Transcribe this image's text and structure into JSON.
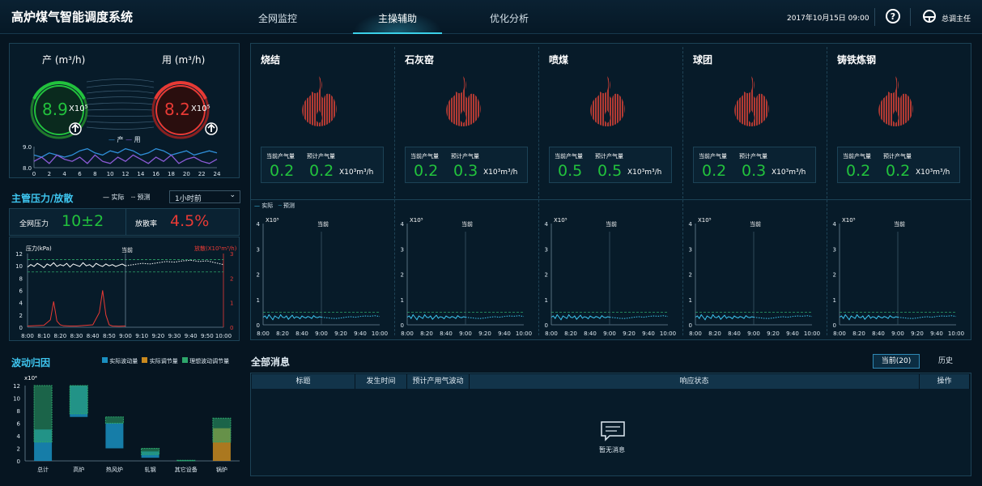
{
  "header": {
    "title": "高炉煤气智能调度系统",
    "nav": [
      "全网监控",
      "主操辅助",
      "优化分析"
    ],
    "active_nav": "主操辅助",
    "datetime": "2017年10月15日  09:00",
    "help_icon": "question-circle-icon",
    "user_icon": "user-icon",
    "user": "总调主任"
  },
  "gauge": {
    "prod_label": "产 (m³/h)",
    "use_label": "用 (m³/h)",
    "prod_value": "8.9",
    "use_value": "8.2",
    "multiplier": "X10⁵",
    "prod_color": "#22c23d",
    "use_color": "#e83a35",
    "up_arrow_icon": "arrow-up-icon",
    "legend_prod": "产",
    "legend_use": "用",
    "chart_data": {
      "type": "line",
      "x": [
        0,
        1,
        2,
        3,
        4,
        5,
        6,
        7,
        8,
        9,
        10,
        11,
        12,
        13,
        14,
        15,
        16,
        17,
        18,
        19,
        20,
        21,
        22,
        23,
        24
      ],
      "xticks": [
        "0",
        "2",
        "4",
        "6",
        "8",
        "10",
        "12",
        "14",
        "16",
        "18",
        "20",
        "22",
        "24"
      ],
      "yticks": [
        "9.0",
        "8.0"
      ],
      "ylim": [
        8.0,
        9.0
      ],
      "series": [
        {
          "name": "产",
          "color": "#2f8fd8",
          "values": [
            8.6,
            8.5,
            8.7,
            8.6,
            8.5,
            8.6,
            8.8,
            8.9,
            8.7,
            8.6,
            8.8,
            8.7,
            8.9,
            8.8,
            8.6,
            8.7,
            8.9,
            8.8,
            8.6,
            8.7,
            8.8,
            8.6,
            8.7,
            8.8,
            8.7
          ]
        },
        {
          "name": "用",
          "color": "#8c5bd6",
          "values": [
            8.3,
            8.5,
            8.2,
            8.6,
            8.4,
            8.3,
            8.5,
            8.2,
            8.6,
            8.3,
            8.2,
            8.5,
            8.3,
            8.6,
            8.4,
            8.2,
            8.5,
            8.3,
            8.6,
            8.2,
            8.4,
            8.5,
            8.3,
            8.2,
            8.4
          ]
        }
      ]
    }
  },
  "pressure": {
    "title": "主管压力/放散",
    "legend_actual": "实际",
    "legend_pred": "预测",
    "select": "1小时前",
    "net_label": "全网压力",
    "net_value": "10±2",
    "diss_label": "放散率",
    "diss_value": "4.5%",
    "left_axis": "压力(kPa)",
    "right_axis": "放散(X10⁵m³/h)",
    "now_label": "当前",
    "chart_data": {
      "type": "line",
      "xticks": [
        "8:00",
        "8:10",
        "8:20",
        "8:30",
        "8:40",
        "8:50",
        "9:00",
        "9:10",
        "9:20",
        "9:30",
        "9:40",
        "9:50",
        "10:00"
      ],
      "yticks_left": [
        "0",
        "2",
        "4",
        "6",
        "8",
        "10",
        "12"
      ],
      "yticks_right": [
        "0",
        "1",
        "2",
        "3"
      ],
      "ylim_left": [
        0,
        12
      ],
      "ylim_right": [
        0,
        3
      ],
      "band": [
        9.0,
        11.0
      ],
      "now": "9:00",
      "series": [
        {
          "name": "实际压力",
          "color": "#ffffff",
          "x": [
            0,
            2,
            4,
            6,
            8,
            10,
            12,
            14,
            16,
            18,
            20,
            22,
            24,
            26,
            28,
            30,
            32,
            34,
            36,
            38,
            40,
            42,
            44,
            46,
            48,
            50,
            52,
            54,
            56,
            58,
            60
          ],
          "values": [
            9.8,
            10.2,
            9.9,
            10.4,
            10.1,
            9.7,
            10.3,
            10.0,
            10.5,
            9.9,
            10.2,
            10.0,
            10.4,
            9.8,
            10.3,
            10.1,
            9.9,
            10.5,
            10.0,
            10.2,
            9.8,
            10.4,
            10.1,
            9.9,
            10.3,
            10.0,
            10.2,
            9.9,
            10.1,
            10.3,
            10.0
          ]
        },
        {
          "name": "预测压力",
          "color": "#ffffff",
          "x": [
            60,
            65,
            70,
            75,
            80,
            85,
            90,
            95,
            100,
            105,
            110,
            115,
            120
          ],
          "values": [
            10.0,
            10.2,
            10.4,
            10.3,
            10.5,
            10.7,
            10.6,
            10.8,
            10.9,
            10.7,
            10.8,
            10.5,
            10.2
          ]
        },
        {
          "name": "放散",
          "color": "#e83a35",
          "x": [
            0,
            10,
            14,
            16,
            18,
            20,
            22,
            26,
            30,
            40,
            44,
            46,
            48,
            50,
            52,
            56,
            60
          ],
          "values": [
            0.05,
            0.08,
            0.3,
            1.05,
            0.25,
            0.1,
            0.06,
            0.05,
            0.05,
            0.1,
            0.6,
            1.5,
            0.5,
            0.1,
            0.05,
            0.04,
            0.05
          ]
        }
      ]
    }
  },
  "fluct": {
    "title": "波动归因",
    "legend": [
      "实际波动量",
      "实际调节量",
      "理想波动调节量"
    ],
    "legend_colors": [
      "#1a8fc0",
      "#c9891e",
      "#2da66b"
    ],
    "unit": "x10⁴",
    "chart_data": {
      "type": "bar",
      "categories": [
        "总计",
        "高炉",
        "热风炉",
        "轧钢",
        "其它设备",
        "锅炉"
      ],
      "yticks": [
        "0",
        "2",
        "4",
        "6",
        "8",
        "10",
        "12"
      ],
      "ylim": [
        0,
        12
      ],
      "series": [
        {
          "name": "实际波动量",
          "values": [
            [
              0,
              5
            ],
            [
              7,
              12
            ],
            [
              2,
              6
            ],
            [
              0.5,
              1.5
            ],
            [
              0,
              0.1
            ],
            [
              0,
              0
            ]
          ]
        },
        {
          "name": "实际调节量",
          "values": [
            [
              0,
              0
            ],
            [
              0,
              0
            ],
            [
              0,
              0
            ],
            [
              0,
              0
            ],
            [
              0,
              0
            ],
            [
              0,
              5.2
            ]
          ]
        },
        {
          "name": "理想波动调节量",
          "values": [
            [
              3,
              12
            ],
            [
              7.5,
              12
            ],
            [
              6,
              7
            ],
            [
              1,
              2
            ],
            [
              0,
              0.1
            ],
            [
              3,
              6.8
            ]
          ]
        }
      ]
    }
  },
  "units": [
    {
      "name": "烧结",
      "cur_label": "当前产气量",
      "pred_label": "预计产气量",
      "cur": "0.2",
      "pred": "0.2",
      "unit": "X10³m³/h"
    },
    {
      "name": "石灰窑",
      "cur_label": "当前产气量",
      "pred_label": "预计产气量",
      "cur": "0.2",
      "pred": "0.3",
      "unit": "X10³m³/h"
    },
    {
      "name": "喷煤",
      "cur_label": "当前产气量",
      "pred_label": "预计产气量",
      "cur": "0.5",
      "pred": "0.5",
      "unit": "X10³m³/h"
    },
    {
      "name": "球团",
      "cur_label": "当前产气量",
      "pred_label": "预计产气量",
      "cur": "0.2",
      "pred": "0.3",
      "unit": "X10³m³/h"
    },
    {
      "name": "铸铁炼钢",
      "cur_label": "当前产气量",
      "pred_label": "预计产气量",
      "cur": "0.2",
      "pred": "0.2",
      "unit": "X10³m³/h"
    }
  ],
  "unit_chart": {
    "legend_actual": "实际",
    "legend_pred": "预测",
    "unit": "X10⁵",
    "now_label": "当前",
    "flame_icon": "flame-icon",
    "chart_data": {
      "type": "line",
      "xticks": [
        "8:00",
        "8:20",
        "8:40",
        "9:00",
        "9:20",
        "9:40",
        "10:00"
      ],
      "yticks": [
        "0",
        "1",
        "2",
        "3",
        "4"
      ],
      "ylim": [
        0,
        4
      ],
      "ref_line": 0.5,
      "now": "9:00",
      "actual": [
        0.3,
        0.35,
        0.25,
        0.4,
        0.3,
        0.2,
        0.35,
        0.3,
        0.25,
        0.4,
        0.3,
        0.28,
        0.35,
        0.22,
        0.3,
        0.38,
        0.26,
        0.32,
        0.3,
        0.24,
        0.35,
        0.3,
        0.27,
        0.33,
        0.3,
        0.25,
        0.36,
        0.3,
        0.28,
        0.32,
        0.3
      ],
      "predicted": [
        0.3,
        0.28,
        0.26,
        0.25,
        0.27,
        0.3,
        0.32,
        0.3,
        0.33,
        0.35,
        0.34,
        0.36,
        0.33
      ]
    }
  },
  "messages": {
    "title": "全部消息",
    "tab_current": "当前(20)",
    "tab_history": "历史",
    "columns": [
      "标题",
      "发生时间",
      "预计产用气波动",
      "响应状态",
      "操作"
    ],
    "empty_icon": "message-icon",
    "empty_text": "暂无消息"
  }
}
